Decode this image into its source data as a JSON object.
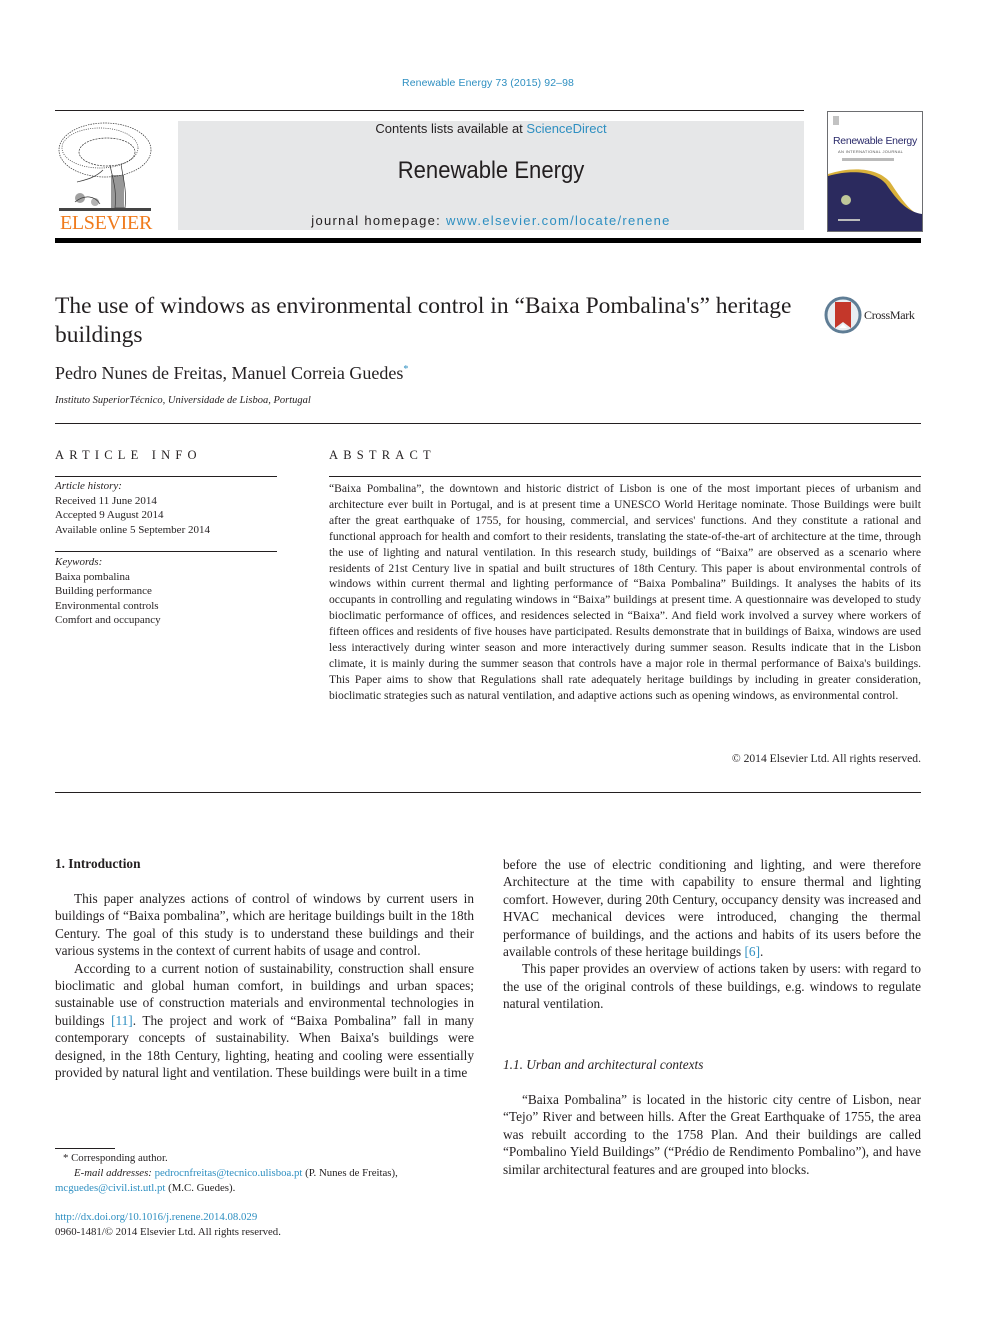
{
  "journal_ref": "Renewable Energy 73 (2015) 92–98",
  "header": {
    "publisher_logo_text": "ELSEVIER",
    "contents_prefix": "Contents lists available at ",
    "contents_link": "ScienceDirect",
    "journal_name": "Renewable Energy",
    "homepage_prefix": "journal homepage: ",
    "homepage_link": "www.elsevier.com/locate/renene",
    "cover_title": "Renewable Energy",
    "cover_subtitle": "AN INTERNATIONAL JOURNAL"
  },
  "article": {
    "title": "The use of windows as environmental control in “Baixa Pombalina's” heritage buildings",
    "crossmark_label": "CrossMark",
    "authors": "Pedro Nunes de Freitas, Manuel Correia Guedes",
    "author_mark": "*",
    "affiliation": "Instituto SuperiorTécnico, Universidade de Lisboa, Portugal"
  },
  "article_info": {
    "heading": "ARTICLE INFO",
    "history_label": "Article history:",
    "history": [
      "Received 11 June 2014",
      "Accepted 9 August 2014",
      "Available online 5 September 2014"
    ],
    "keywords_label": "Keywords:",
    "keywords": [
      "Baixa pombalina",
      "Building performance",
      "Environmental controls",
      "Comfort and occupancy"
    ]
  },
  "abstract": {
    "heading": "ABSTRACT",
    "text": "“Baixa Pombalina”, the downtown and historic district of Lisbon is one of the most important pieces of urbanism and architecture ever built in Portugal, and is at present time a UNESCO World Heritage nominate. Those Buildings were built after the great earthquake of 1755, for housing, commercial, and services' functions. And they constitute a rational and functional approach for health and comfort to their residents, translating the state-of-the-art of architecture at the time, through the use of lighting and natural ventilation. In this research study, buildings of “Baixa” are observed as a scenario where residents of 21st Century live in spatial and built structures of 18th Century. This paper is about environmental controls of windows within current thermal and lighting performance of “Baixa Pombalina” Buildings. It analyses the habits of its occupants in controlling and regulating windows in “Baixa” buildings at present time. A questionnaire was developed to study bioclimatic performance of offices, and residences selected in “Baixa”. And field work involved a survey where workers of fifteen offices and residents of five houses have participated. Results demonstrate that in buildings of Baixa, windows are used less interactively during winter season and more interactively during summer season. Results indicate that in the Lisbon climate, it is mainly during the summer season that controls have a major role in thermal performance of Baixa's buildings. This Paper aims to show that Regulations shall rate adequately heritage buildings by including in greater consideration, bioclimatic strategies such as natural ventilation, and adaptive actions such as opening windows, as environmental control.",
    "copyright": "© 2014 Elsevier Ltd. All rights reserved."
  },
  "body": {
    "section1_heading": "1.  Introduction",
    "left_p1": "This paper analyzes actions of control of windows by current users in buildings of “Baixa pombalina”, which are heritage buildings built in the 18th Century. The goal of this study is to understand these buildings and their various systems in the context of current habits of usage and control.",
    "left_p2_a": "According to a current notion of sustainability, construction shall ensure bioclimatic and global human comfort, in buildings and urban spaces; sustainable use of construction materials and environmental technologies in buildings ",
    "left_p2_ref": "[11]",
    "left_p2_b": ". The project and work of “Baixa Pombalina” fall in many contemporary concepts of sustainability. When Baixa's buildings were designed, in the 18th Century, lighting, heating and cooling were essentially provided by natural light and ventilation. These buildings were built in a time",
    "right_p1_a": "before the use of electric conditioning and lighting, and were therefore Architecture at the time with capability to ensure thermal and lighting comfort. However, during 20th Century, occupancy density was increased and HVAC mechanical devices were introduced, changing the thermal performance of buildings, and the actions and habits of its users before the available controls of these heritage buildings ",
    "right_p1_ref": "[6]",
    "right_p1_b": ".",
    "right_p2": "This paper provides an overview of actions taken by users: with regard to the use of the original controls of these buildings, e.g. windows to regulate natural ventilation.",
    "subsection_heading": "1.1.  Urban and architectural contexts",
    "right_p3": "“Baixa Pombalina” is located in the historic city centre of Lisbon, near “Tejo” River and between hills. After the Great Earthquake of 1755, the area was rebuilt according to the 1758 Plan. And their buildings are called “Pombalino Yield Buildings” (“Prédio de Rendimento Pombalino”), and have similar architectural features and are grouped into blocks."
  },
  "footnote": {
    "corresponding": "* Corresponding author.",
    "email_label": "E-mail addresses: ",
    "email1": "pedrocnfreitas@tecnico.ulisboa.pt",
    "email1_owner": " (P. Nunes de Freitas),",
    "email2": "mcguedes@civil.ist.utl.pt",
    "email2_owner": " (M.C. Guedes).",
    "doi": "http://dx.doi.org/10.1016/j.renene.2014.08.029",
    "issn": "0960-1481/© 2014 Elsevier Ltd. All rights reserved."
  },
  "colors": {
    "link": "#2e8fc1",
    "elsevier_orange": "#f07b1d",
    "masthead_bg": "#e6e7e8",
    "cover_navy": "#2b2a5e",
    "cover_gold": "#d9b13b",
    "crossmark_red": "#c4372a"
  }
}
